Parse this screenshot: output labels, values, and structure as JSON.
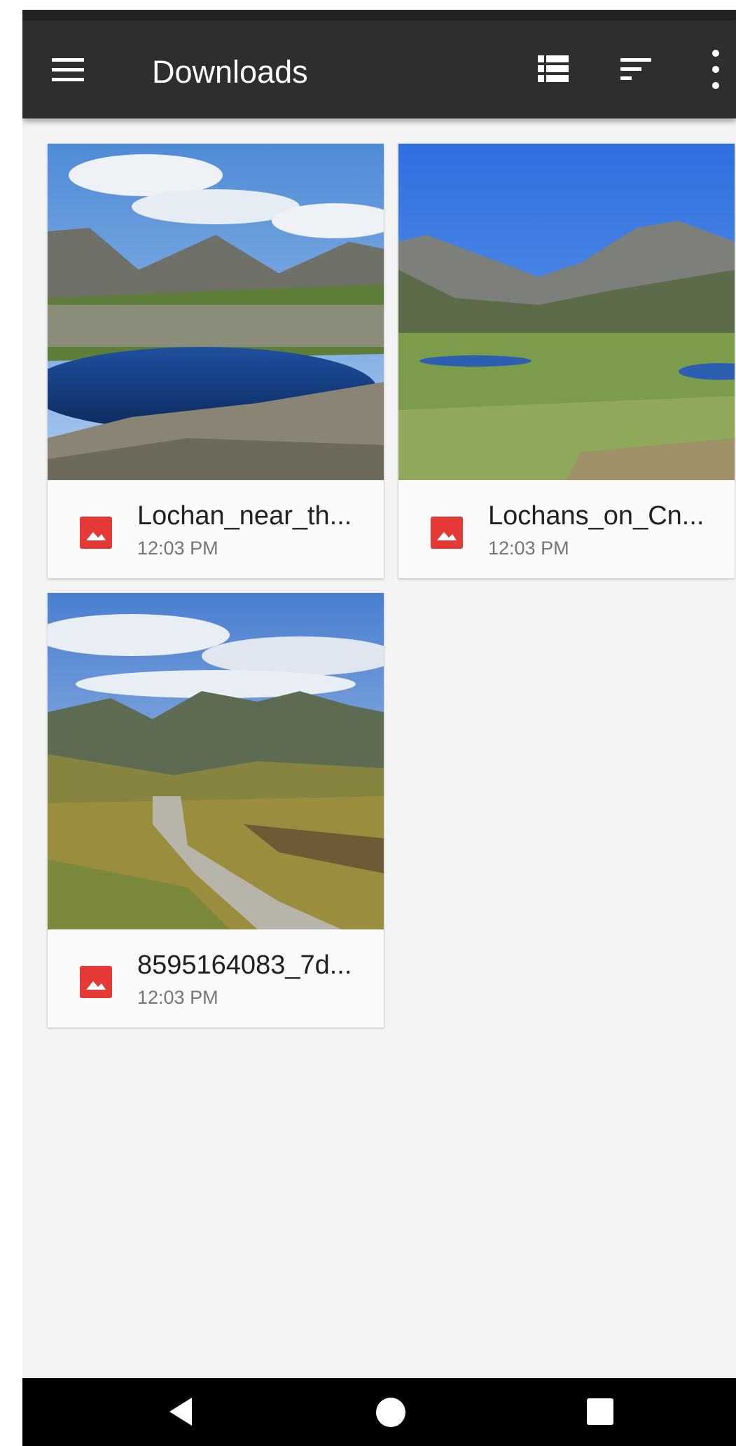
{
  "app_bar": {
    "title": "Downloads",
    "icons": [
      "menu-icon",
      "list-view-icon",
      "sort-icon",
      "more-vert-icon"
    ]
  },
  "files": [
    {
      "name": "Lochan_near_th...",
      "time": "12:03 PM",
      "icon": "image-file-icon"
    },
    {
      "name": "Lochans_on_Cn...",
      "time": "12:03 PM",
      "icon": "image-file-icon"
    },
    {
      "name": "8595164083_7d...",
      "time": "12:03 PM",
      "icon": "image-file-icon"
    }
  ],
  "nav_bar": {
    "icons": [
      "back-icon",
      "home-icon",
      "recents-icon"
    ]
  },
  "colors": {
    "app_bar": "#2e2e2e",
    "background": "#f3f3f3",
    "file_icon": "#e53935",
    "nav_bar": "#000000"
  }
}
